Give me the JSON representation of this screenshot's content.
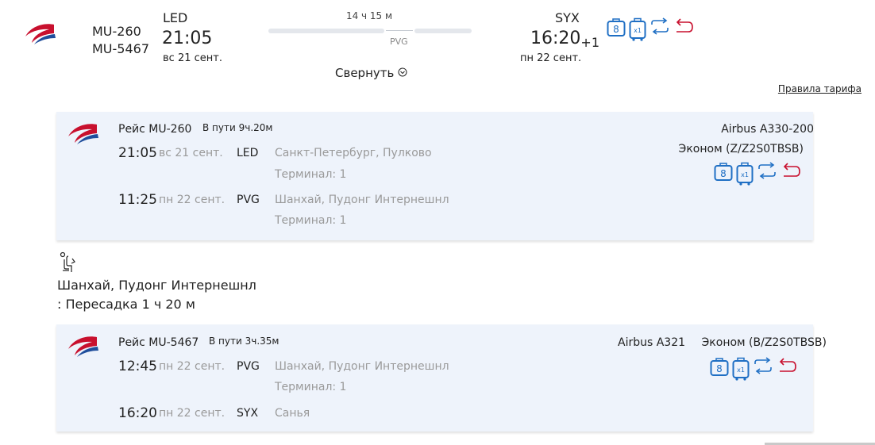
{
  "summary": {
    "flights": [
      "MU-260",
      "MU-5467"
    ],
    "origin": {
      "iata": "LED",
      "time": "21:05",
      "date": "вс 21 сент."
    },
    "destination": {
      "iata": "SYX",
      "time": "16:20",
      "plus_day": "+1",
      "date": "пн 22 сент."
    },
    "duration": "14 ч 15 м",
    "via": "PVG",
    "collapse_label": "Свернуть",
    "collapse_icon": "chevron-down-circle-icon",
    "fare_rules_label": "Правила тарифа",
    "baggage_cabin_count": "8",
    "baggage_checked_count": "x1"
  },
  "segments": [
    {
      "title": "Рейс MU-260",
      "duration": "В пути 9ч.20м",
      "aircraft": "Airbus A330-200",
      "cabin": "Эконом (Z/Z2S0TBSB)",
      "baggage_cabin_count": "8",
      "baggage_checked_count": "x1",
      "dep": {
        "time": "21:05",
        "date": "вс 21 сент.",
        "iata": "LED",
        "place": "Санкт-Петербург, Пулково",
        "terminal": "Терминал: 1"
      },
      "arr": {
        "time": "11:25",
        "date": "пн 22 сент.",
        "iata": "PVG",
        "place": "Шанхай, Пудонг Интернешнл",
        "terminal": "Терминал: 1"
      }
    },
    {
      "title": "Рейс MU-5467",
      "duration": "В пути 3ч.35м",
      "aircraft": "Airbus A321",
      "cabin": "Эконом (B/Z2S0TBSB)",
      "baggage_cabin_count": "8",
      "baggage_checked_count": "x1",
      "dep": {
        "time": "12:45",
        "date": "пн 22 сент.",
        "iata": "PVG",
        "place": "Шанхай, Пудонг Интернешнл",
        "terminal": "Терминал: 1"
      },
      "arr": {
        "time": "16:20",
        "date": "пн 22 сент.",
        "iata": "SYX",
        "place": "Санья",
        "terminal": ""
      }
    }
  ],
  "transfer": {
    "icon": "waiting-seat-icon",
    "airport": "Шанхай, Пудонг Интернешнл",
    "text": ": Пересадка 1 ч 20 м"
  },
  "colors": {
    "brand_blue": "#1f6fc4",
    "brand_red": "#c8102e",
    "card_bg": "#eef3fb",
    "muted_text": "#9a9a9a"
  }
}
